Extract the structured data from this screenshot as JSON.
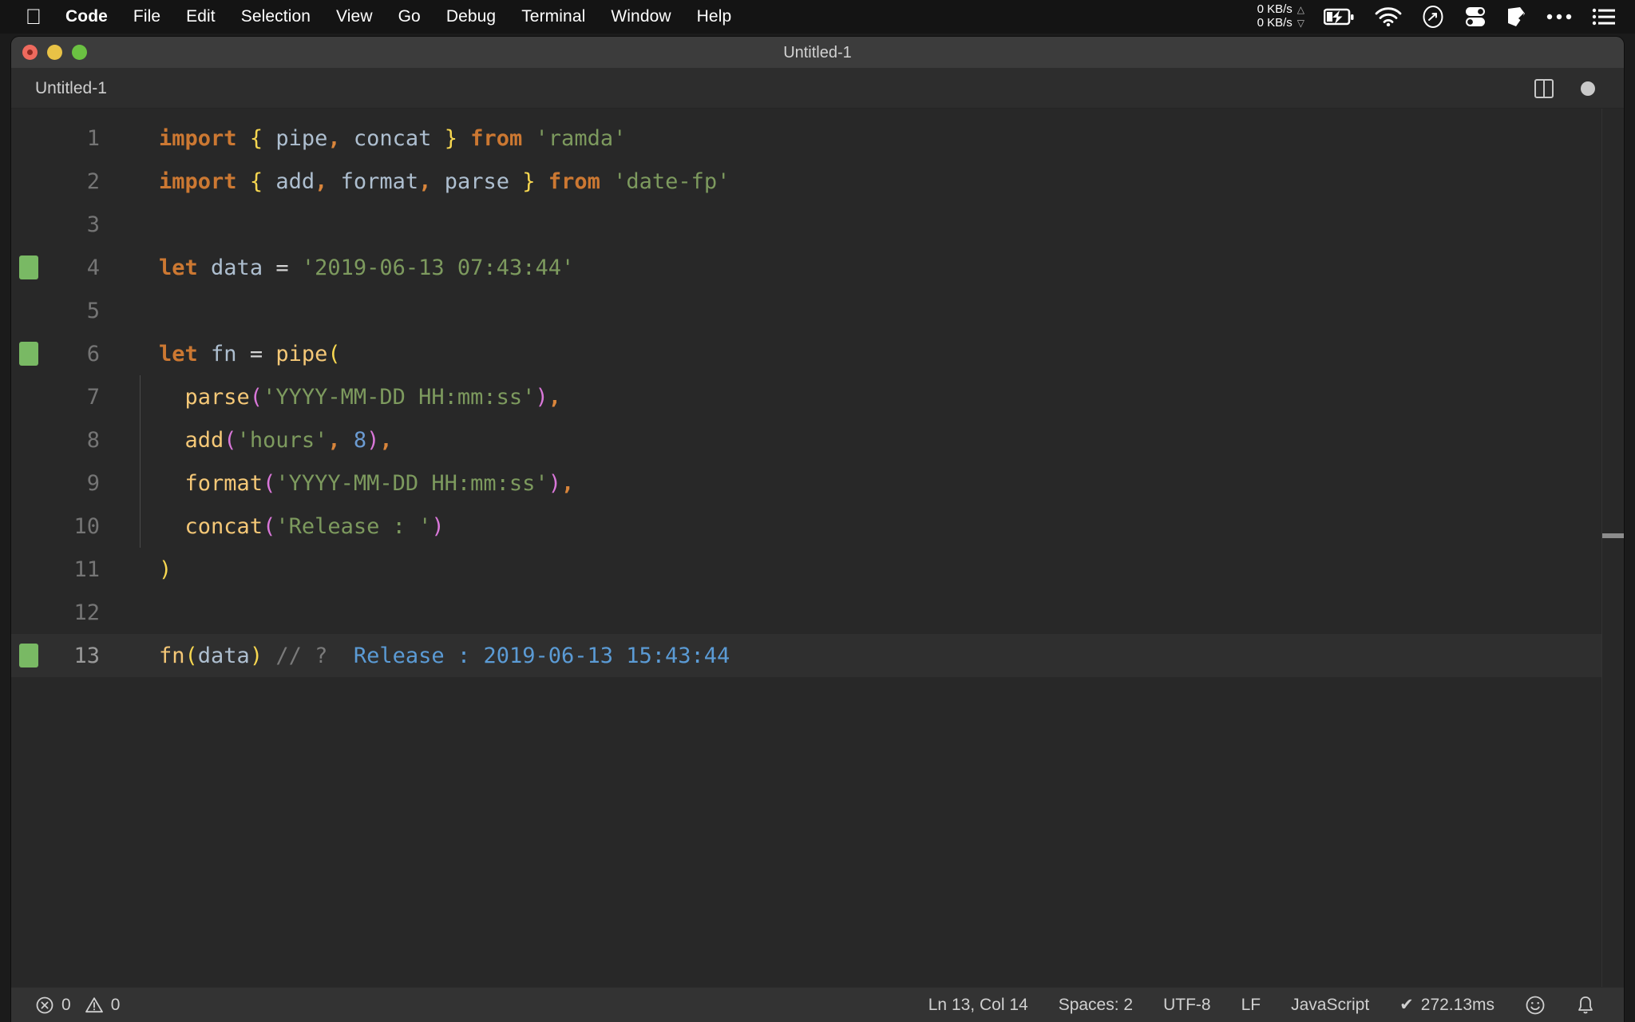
{
  "menubar": {
    "apple_icon": "apple-logo-icon",
    "items": [
      {
        "label": "Code",
        "bold": true
      },
      {
        "label": "File",
        "bold": false
      },
      {
        "label": "Edit",
        "bold": false
      },
      {
        "label": "Selection",
        "bold": false
      },
      {
        "label": "View",
        "bold": false
      },
      {
        "label": "Go",
        "bold": false
      },
      {
        "label": "Debug",
        "bold": false
      },
      {
        "label": "Terminal",
        "bold": false
      },
      {
        "label": "Window",
        "bold": false
      },
      {
        "label": "Help",
        "bold": false
      }
    ],
    "network_speed": {
      "upload": "0 KB/s",
      "download": "0 KB/s",
      "up_arrow": "triangle-up-icon",
      "down_arrow": "triangle-down-icon"
    },
    "status_icons": [
      "battery-charging-icon",
      "wifi-icon",
      "clock-icon",
      "toggles-icon",
      "shape-icon",
      "ellipsis-icon",
      "list-icon"
    ]
  },
  "window": {
    "title": "Untitled-1",
    "traffic_lights": [
      "close-button",
      "minimize-button",
      "zoom-button"
    ]
  },
  "tabbar": {
    "tabs": [
      {
        "label": "Untitled-1",
        "active": true,
        "dirty": true
      }
    ],
    "split_editor_label": "split-editor",
    "dirty_indicator_label": "unsaved-changes"
  },
  "editor": {
    "language": "JavaScript",
    "lines": [
      {
        "number": "1",
        "gutter": false,
        "tokens": [
          {
            "t": "import",
            "c": "kw"
          },
          {
            "t": " ",
            "c": "op"
          },
          {
            "t": "{",
            "c": "brc"
          },
          {
            "t": " ",
            "c": "op"
          },
          {
            "t": "pipe",
            "c": "var"
          },
          {
            "t": ",",
            "c": "kw2"
          },
          {
            "t": " ",
            "c": "op"
          },
          {
            "t": "concat",
            "c": "var"
          },
          {
            "t": " ",
            "c": "op"
          },
          {
            "t": "}",
            "c": "brc"
          },
          {
            "t": " ",
            "c": "op"
          },
          {
            "t": "from",
            "c": "kw"
          },
          {
            "t": " ",
            "c": "op"
          },
          {
            "t": "'ramda'",
            "c": "str"
          }
        ]
      },
      {
        "number": "2",
        "gutter": false,
        "tokens": [
          {
            "t": "import",
            "c": "kw"
          },
          {
            "t": " ",
            "c": "op"
          },
          {
            "t": "{",
            "c": "brc"
          },
          {
            "t": " ",
            "c": "op"
          },
          {
            "t": "add",
            "c": "var"
          },
          {
            "t": ",",
            "c": "kw2"
          },
          {
            "t": " ",
            "c": "op"
          },
          {
            "t": "format",
            "c": "var"
          },
          {
            "t": ",",
            "c": "kw2"
          },
          {
            "t": " ",
            "c": "op"
          },
          {
            "t": "parse",
            "c": "var"
          },
          {
            "t": " ",
            "c": "op"
          },
          {
            "t": "}",
            "c": "brc"
          },
          {
            "t": " ",
            "c": "op"
          },
          {
            "t": "from",
            "c": "kw"
          },
          {
            "t": " ",
            "c": "op"
          },
          {
            "t": "'date-fp'",
            "c": "str"
          }
        ]
      },
      {
        "number": "3",
        "gutter": false,
        "tokens": []
      },
      {
        "number": "4",
        "gutter": true,
        "tokens": [
          {
            "t": "let",
            "c": "kw"
          },
          {
            "t": " ",
            "c": "op"
          },
          {
            "t": "data",
            "c": "var"
          },
          {
            "t": " = ",
            "c": "op"
          },
          {
            "t": "'2019-06-13 07:43:44'",
            "c": "str"
          }
        ]
      },
      {
        "number": "5",
        "gutter": false,
        "tokens": []
      },
      {
        "number": "6",
        "gutter": true,
        "tokens": [
          {
            "t": "let",
            "c": "kw"
          },
          {
            "t": " ",
            "c": "op"
          },
          {
            "t": "fn",
            "c": "var"
          },
          {
            "t": " = ",
            "c": "op"
          },
          {
            "t": "pipe",
            "c": "fn"
          },
          {
            "t": "(",
            "c": "yparen"
          }
        ]
      },
      {
        "number": "7",
        "gutter": false,
        "tokens": [
          {
            "t": "  ",
            "c": "op"
          },
          {
            "t": "parse",
            "c": "fn"
          },
          {
            "t": "(",
            "c": "paren"
          },
          {
            "t": "'YYYY-MM-DD HH:mm:ss'",
            "c": "str"
          },
          {
            "t": ")",
            "c": "paren"
          },
          {
            "t": ",",
            "c": "kw2"
          }
        ]
      },
      {
        "number": "8",
        "gutter": false,
        "tokens": [
          {
            "t": "  ",
            "c": "op"
          },
          {
            "t": "add",
            "c": "fn"
          },
          {
            "t": "(",
            "c": "paren"
          },
          {
            "t": "'hours'",
            "c": "str"
          },
          {
            "t": ",",
            "c": "kw2"
          },
          {
            "t": " ",
            "c": "op"
          },
          {
            "t": "8",
            "c": "num"
          },
          {
            "t": ")",
            "c": "paren"
          },
          {
            "t": ",",
            "c": "kw2"
          }
        ]
      },
      {
        "number": "9",
        "gutter": false,
        "tokens": [
          {
            "t": "  ",
            "c": "op"
          },
          {
            "t": "format",
            "c": "fn"
          },
          {
            "t": "(",
            "c": "paren"
          },
          {
            "t": "'YYYY-MM-DD HH:mm:ss'",
            "c": "str"
          },
          {
            "t": ")",
            "c": "paren"
          },
          {
            "t": ",",
            "c": "kw2"
          }
        ]
      },
      {
        "number": "10",
        "gutter": false,
        "tokens": [
          {
            "t": "  ",
            "c": "op"
          },
          {
            "t": "concat",
            "c": "fn"
          },
          {
            "t": "(",
            "c": "paren"
          },
          {
            "t": "'Release : '",
            "c": "str"
          },
          {
            "t": ")",
            "c": "paren"
          }
        ]
      },
      {
        "number": "11",
        "gutter": false,
        "tokens": [
          {
            "t": ")",
            "c": "yparen"
          }
        ]
      },
      {
        "number": "12",
        "gutter": false,
        "tokens": []
      },
      {
        "number": "13",
        "gutter": true,
        "current": true,
        "tokens": [
          {
            "t": "fn",
            "c": "fn"
          },
          {
            "t": "(",
            "c": "yparen"
          },
          {
            "t": "data",
            "c": "var"
          },
          {
            "t": ")",
            "c": "yparen"
          },
          {
            "t": " ",
            "c": "op"
          },
          {
            "t": "// ?",
            "c": "cmt"
          },
          {
            "t": "  ",
            "c": "op"
          },
          {
            "t": "Release : 2019-06-13 15:43:44",
            "c": "res"
          }
        ]
      }
    ]
  },
  "statusbar": {
    "errors_icon": "error-circle-icon",
    "errors_count": "0",
    "warnings_icon": "warning-triangle-icon",
    "warnings_count": "0",
    "cursor_position": "Ln 13, Col 14",
    "indentation": "Spaces: 2",
    "encoding": "UTF-8",
    "line_ending": "LF",
    "language_mode": "JavaScript",
    "run_check_icon": "check-icon",
    "run_time": "272.13ms",
    "feedback_icon": "smiley-icon",
    "notifications_icon": "bell-icon"
  },
  "colors": {
    "menubar_bg": "#141414",
    "titlebar_bg": "#3c3c3c",
    "tabbar_bg": "#2d2d2d",
    "editor_bg": "#282828",
    "statusbar_bg": "#333333",
    "git_added_marker": "#79b964",
    "keyword": "#cc7832",
    "string": "#7d9a5e",
    "function": "#f5c877",
    "paren": "#d977d9",
    "number": "#6b9bd2",
    "inline_result": "#5b9bd5",
    "comment": "#7a7a7a",
    "brace": "#f7d750"
  }
}
